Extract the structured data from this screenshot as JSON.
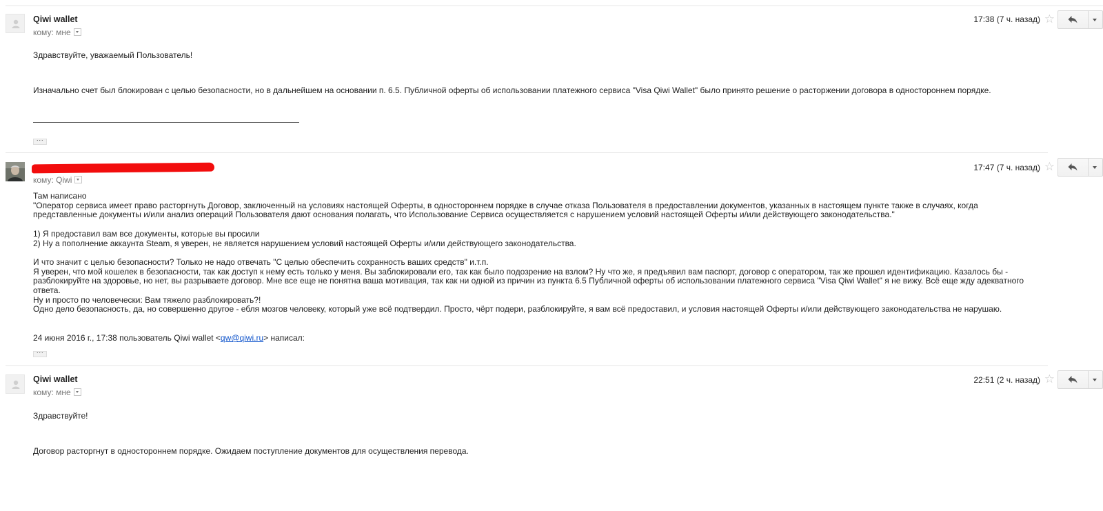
{
  "messages": [
    {
      "sender": "Qiwi wallet",
      "recipient_label": "кому: мне",
      "time": "17:38 (7 ч. назад)",
      "greeting": "Здравствуйте, уважаемый Пользователь!",
      "paragraph": "Изначально счет был блокирован с целью безопасности, но в дальнейшем на основании п. 6.5. Публичной оферты об использовании платежного сервиса \"Visa Qiwi Wallet\" было принято решение о расторжении договора в одностороннем порядке.",
      "ellipsis": "···"
    },
    {
      "recipient_label": "кому: Qiwi",
      "time": "17:47 (7 ч. назад)",
      "lines": [
        "Там написано",
        "\"Оператор сервиса имеет право расторгнуть Договор, заключенный на условиях настоящей Оферты, в одностороннем порядке в случае отказа Пользователя в предоставлении документов, указанных в настоящем пункте также в случаях, когда представленные документы и/или анализ операций Пользователя дают основания полагать, что Использование Сервиса осуществляется с нарушением условий настоящей Оферты и/или действующего законодательства.\"",
        "",
        "1) Я предоставил вам все документы, которые вы просили",
        "2) Ну а пополнение аккаунта Steam, я уверен, не является нарушением условий настоящей Оферты и/или действующего законодательства.",
        "",
        "И что значит с целью безопасности? Только не надо отвечать \"С целью обеспечить сохранность ваших средств\" и.т.п.",
        "Я уверен, что мой кошелек в безопасности, так как доступ к нему есть только у меня. Вы заблокировали его, так как было подозрение на взлом? Ну что же, я предъявил вам паспорт, договор с оператором, так же прошел идентификацию. Казалось бы - разблокируйте на здоровье, но нет, вы разрываете договор. Мне все еще не понятна ваша мотивация, так как ни одной из причин из пункта 6.5 Публичной оферты об использовании платежного сервиса \"Visa Qiwi Wallet\"  я не вижу. Всё еще жду адекватного ответа.",
        "Ну и просто по человечески: Вам тяжело разблокировать?!",
        "Одно дело безопасность, да, но совершенно другое - ебля мозгов человеку, который уже всё подтвердил. Просто, чёрт подери, разблокируйте, я вам всё предоставил, и условия настоящей Оферты и/или действующего законодательства не нарушаю."
      ],
      "quote_prefix": "24 июня 2016 г., 17:38 пользователь Qiwi wallet <",
      "quote_email": "qw@qiwi.ru",
      "quote_suffix": "> написал:",
      "ellipsis": "···"
    },
    {
      "sender": "Qiwi wallet",
      "recipient_label": "кому: мне",
      "time": "22:51 (2 ч. назад)",
      "greeting": "Здравствуйте!",
      "paragraph": "Договор расторгнут в одностороннем порядке. Ожидаем поступление документов для осуществления перевода."
    }
  ],
  "icons": {
    "star": "star-icon",
    "reply": "reply-icon",
    "more": "chevron-down-icon",
    "avatar": "default-avatar-icon"
  }
}
